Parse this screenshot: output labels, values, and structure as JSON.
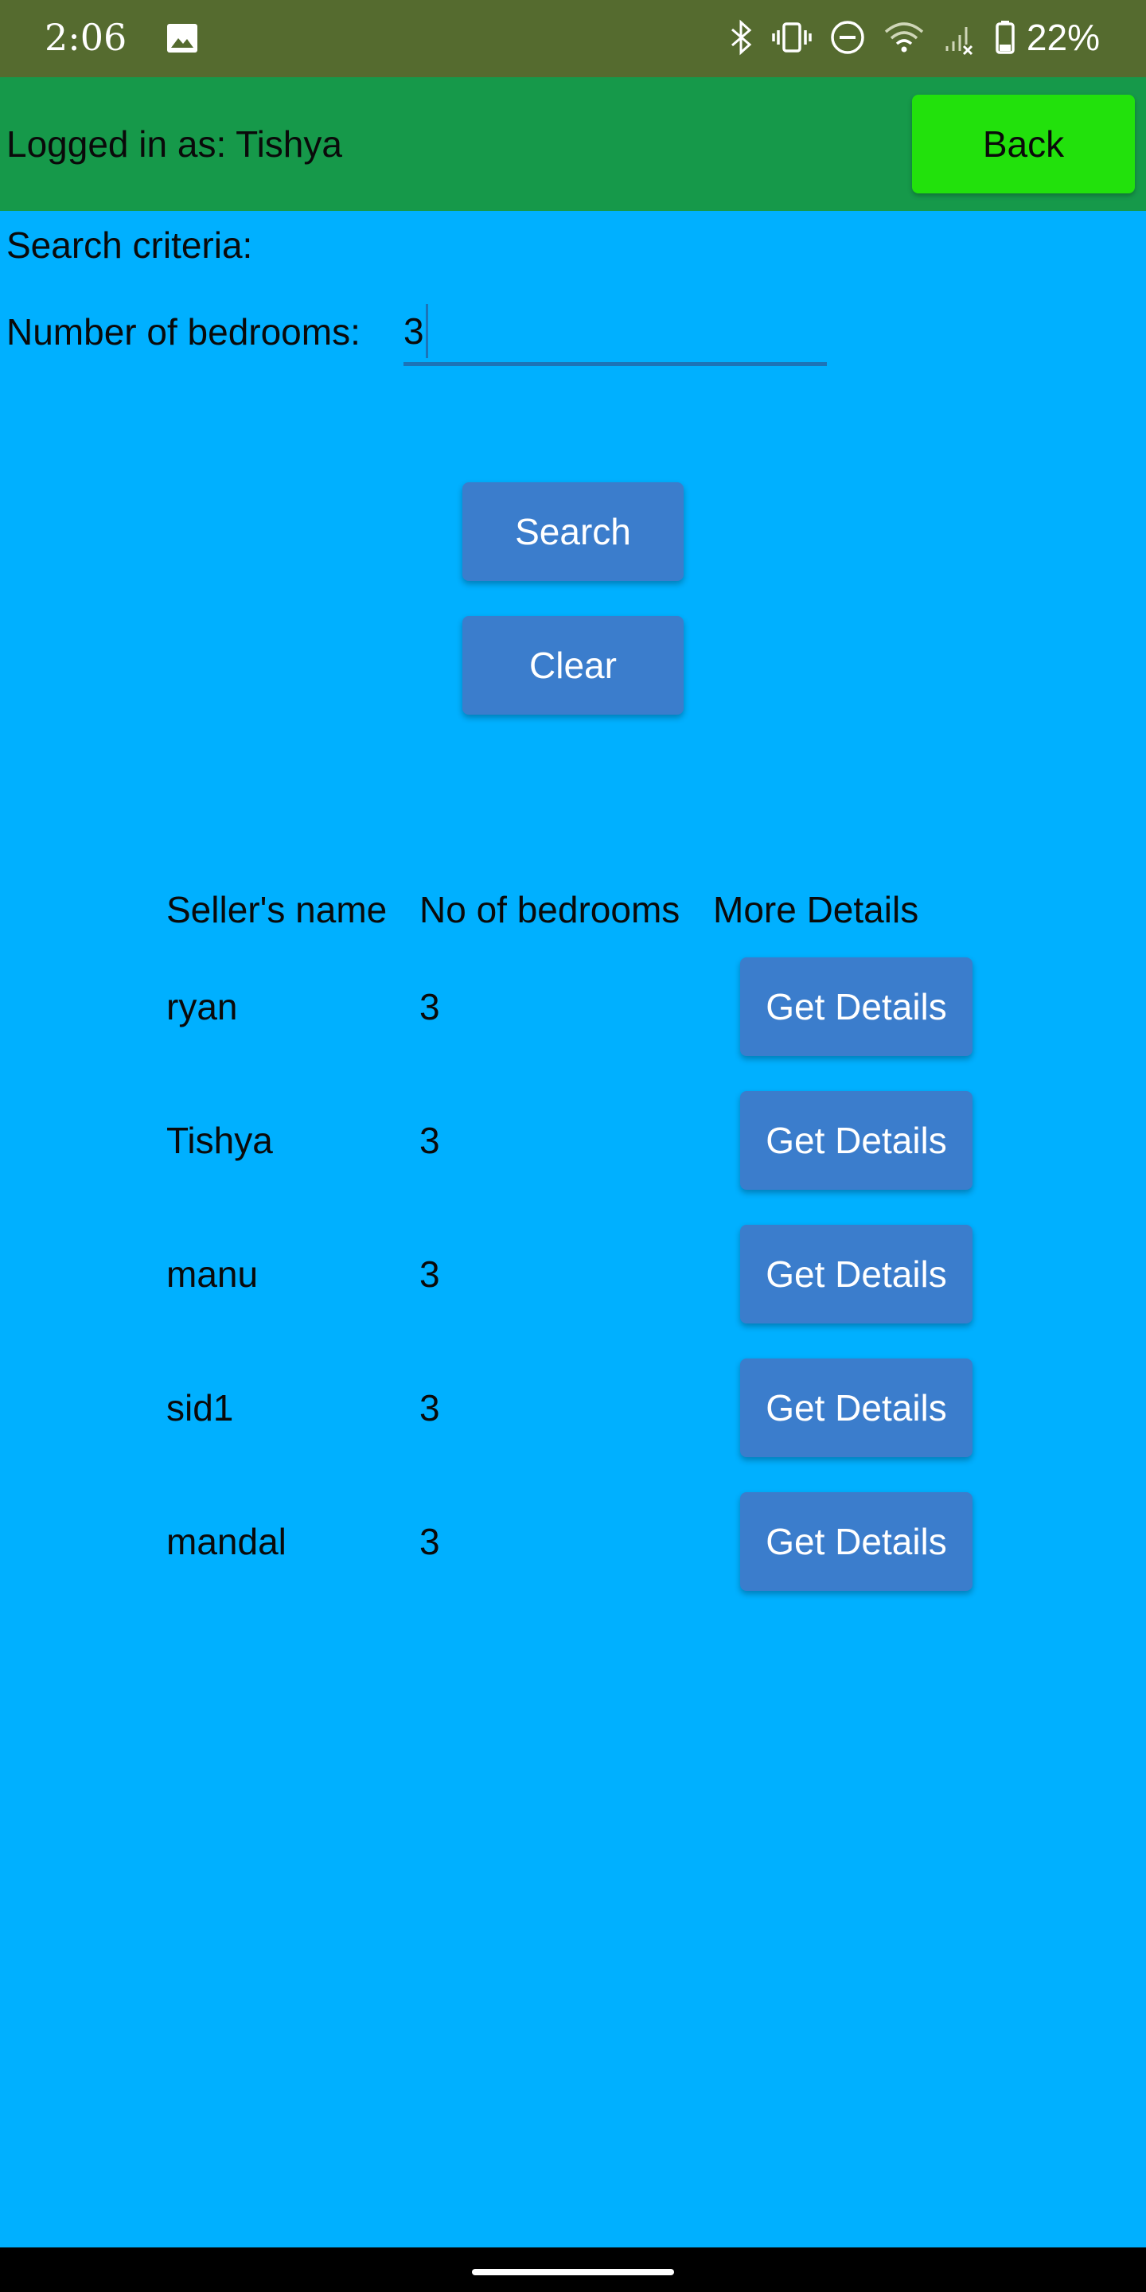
{
  "status_bar": {
    "time": "2:06",
    "battery": "22%",
    "icons": [
      "image-icon",
      "bluetooth-icon",
      "vibrate-icon",
      "do-not-disturb-icon",
      "wifi-icon",
      "signal-icon",
      "battery-icon"
    ]
  },
  "header": {
    "logged_in_text": "Logged in as: Tishya",
    "back_label": "Back"
  },
  "search": {
    "criteria_label": "Search criteria:",
    "bedrooms_label": "Number of bedrooms:",
    "bedrooms_value": "3",
    "search_label": "Search",
    "clear_label": "Clear"
  },
  "results": {
    "columns": [
      "Seller's name",
      "No of bedrooms",
      "More Details"
    ],
    "rows": [
      {
        "name": "ryan",
        "bedrooms": "3",
        "action": "Get Details"
      },
      {
        "name": "Tishya",
        "bedrooms": "3",
        "action": "Get Details"
      },
      {
        "name": "manu",
        "bedrooms": "3",
        "action": "Get Details"
      },
      {
        "name": "sid1",
        "bedrooms": "3",
        "action": "Get Details"
      },
      {
        "name": "mandal",
        "bedrooms": "3",
        "action": "Get Details"
      }
    ]
  },
  "colors": {
    "background": "#00b0ff",
    "status_bar": "#556b2f",
    "app_bar": "#16994a",
    "back_button": "#22e10c",
    "button": "#3b7dcc"
  }
}
